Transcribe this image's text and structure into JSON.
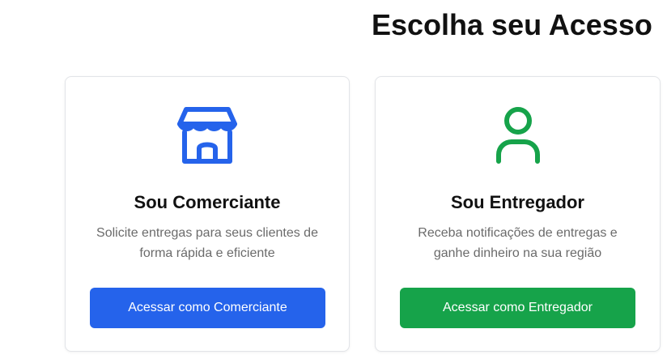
{
  "page": {
    "title": "Escolha seu Acesso"
  },
  "cards": {
    "merchant": {
      "icon": "storefront-icon",
      "title": "Sou Comerciante",
      "description": "Solicite entregas para seus clientes de forma rápida e eficiente",
      "button_label": "Acessar como Comerciante",
      "accent_color": "#2563eb"
    },
    "courier": {
      "icon": "user-icon",
      "title": "Sou Entregador",
      "description": "Receba notificações de entregas e ganhe dinheiro na sua região",
      "button_label": "Acessar como Entregador",
      "accent_color": "#16a34a"
    }
  }
}
